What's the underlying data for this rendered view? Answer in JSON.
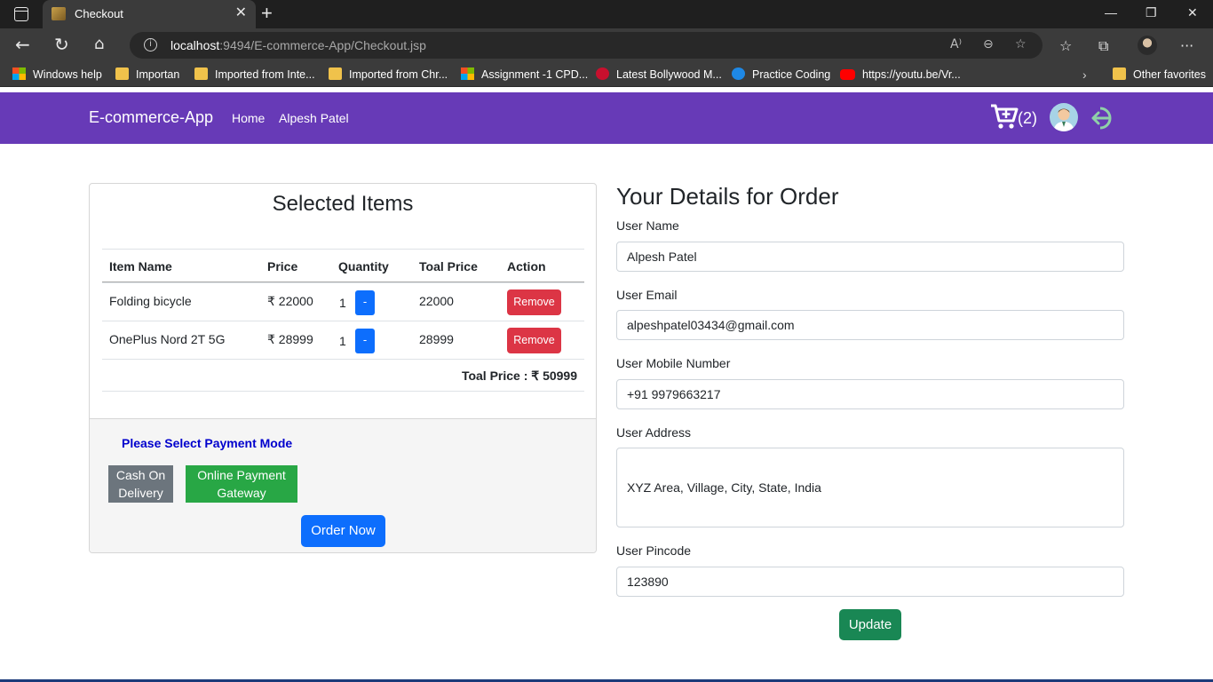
{
  "browser": {
    "tab_title": "Checkout",
    "tab_close": "✕",
    "new_tab": "+",
    "url_host": "localhost",
    "url_rest": ":9494/E-commerce-App/Checkout.jsp",
    "window_controls": {
      "minimize": "—",
      "restore": "❐",
      "close": "✕"
    }
  },
  "bookmarks": [
    {
      "label": "Windows help",
      "icon": "windows-icon"
    },
    {
      "label": "Importan",
      "icon": "folder-icon"
    },
    {
      "label": "Imported from Inte...",
      "icon": "folder-icon"
    },
    {
      "label": "Imported from Chr...",
      "icon": "folder-icon"
    },
    {
      "label": "Assignment -1 CPD...",
      "icon": "windows-icon"
    },
    {
      "label": "Latest Bollywood M...",
      "icon": "m-icon"
    },
    {
      "label": "Practice Coding",
      "icon": "pb-icon"
    },
    {
      "label": "https://youtu.be/Vr...",
      "icon": "youtube-icon"
    },
    {
      "label": "Other favorites",
      "icon": "folder-icon"
    }
  ],
  "site": {
    "brand": "E-commerce-App",
    "nav_home": "Home",
    "nav_user": "Alpesh Patel",
    "cart_count": "(2)",
    "brand_color": "#673ab7"
  },
  "cart": {
    "title": "Selected Items",
    "columns": [
      "Item Name",
      "Price",
      "Quantity",
      "Toal Price",
      "Action"
    ],
    "rows": [
      {
        "name": "Folding bicycle",
        "price": "₹ 22000",
        "qty": "1",
        "minus": "-",
        "total": "22000",
        "action": "Remove"
      },
      {
        "name": "OnePlus Nord 2T 5G",
        "price": "₹ 28999",
        "qty": "1",
        "minus": "-",
        "total": "28999",
        "action": "Remove"
      }
    ],
    "total_label": "Toal Price : ₹ 50999",
    "payment_title": "Please Select Payment Mode",
    "cod_line1": "Cash On",
    "cod_line2": "Delivery",
    "online_line1": "Online Payment",
    "online_line2": "Gateway",
    "order_button": "Order Now"
  },
  "details": {
    "title": "Your Details for Order",
    "name_label": "User Name",
    "name_value": "Alpesh Patel",
    "email_label": "User Email",
    "email_value": "alpeshpatel03434@gmail.com",
    "mobile_label": "User Mobile Number",
    "mobile_value": "+91 9979663217",
    "address_label": "User Address",
    "address_value": "XYZ Area, Village, City, State, India",
    "pincode_label": "User Pincode",
    "pincode_value": "123890",
    "update_button": "Update"
  }
}
